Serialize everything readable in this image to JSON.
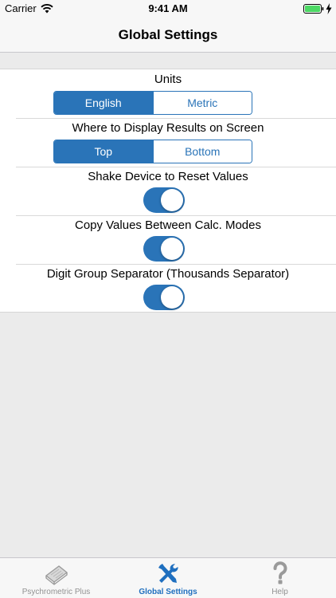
{
  "status_bar": {
    "carrier": "Carrier",
    "time": "9:41 AM"
  },
  "nav": {
    "title": "Global Settings"
  },
  "settings": {
    "units": {
      "label": "Units",
      "options": [
        "English",
        "Metric"
      ],
      "selected": "English"
    },
    "display_results": {
      "label": "Where to Display Results on Screen",
      "options": [
        "Top",
        "Bottom"
      ],
      "selected": "Top"
    },
    "shake_reset": {
      "label": "Shake Device to Reset Values",
      "on": true
    },
    "copy_values": {
      "label": "Copy Values Between Calc. Modes",
      "on": true
    },
    "digit_separator": {
      "label": "Digit Group Separator (Thousands Separator)",
      "on": true
    }
  },
  "tab_bar": {
    "items": [
      {
        "label": "Psychrometric Plus",
        "icon": "book-icon",
        "active": false
      },
      {
        "label": "Global Settings",
        "icon": "tools-icon",
        "active": true
      },
      {
        "label": "Help",
        "icon": "question-icon",
        "active": false
      }
    ]
  },
  "colors": {
    "accent": "#2a74b8",
    "tab_active": "#1f6fbf",
    "tab_inactive": "#929292",
    "background": "#ebebeb"
  }
}
